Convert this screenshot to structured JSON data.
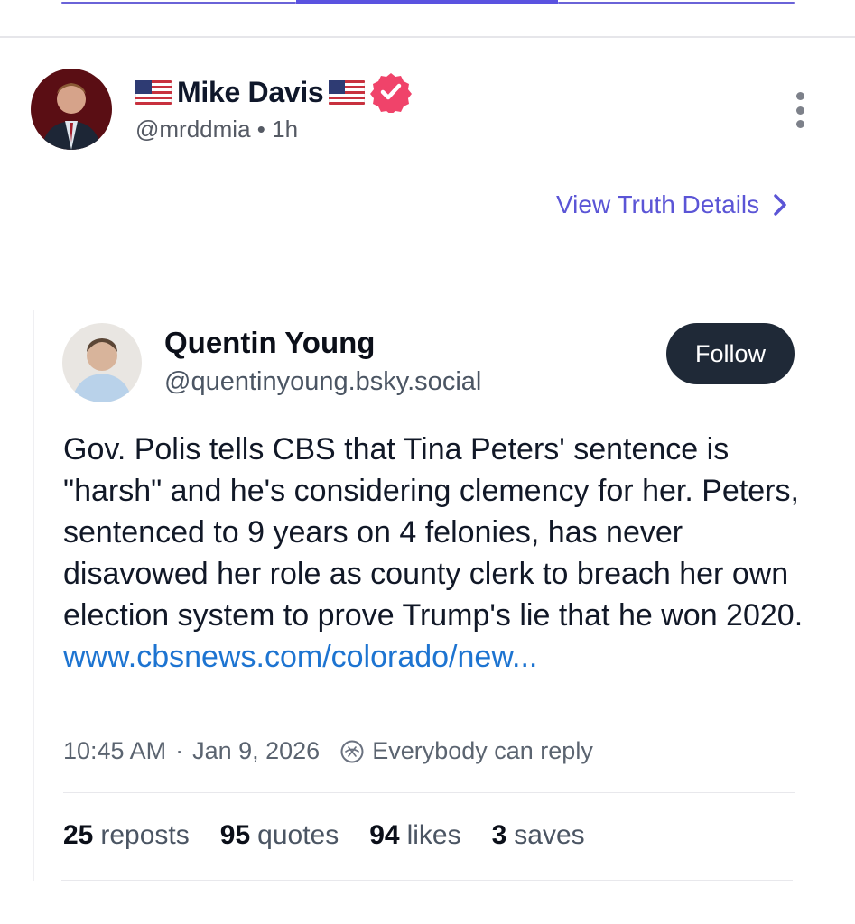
{
  "post": {
    "display_name": "Mike Davis",
    "handle": "@mrddmia",
    "time_sep": "•",
    "time": "1h",
    "view_details": "View Truth Details",
    "icons": {
      "avatar": "avatar-photo",
      "flag": "us-flag-icon",
      "verified": "verified-badge-icon",
      "more": "more-vertical-icon",
      "chevron": "chevron-right-icon"
    }
  },
  "quote": {
    "name": "Quentin Young",
    "handle": "@quentinyoung.bsky.social",
    "follow_label": "Follow",
    "body": "Gov. Polis tells CBS that Tina Peters' sentence is \"harsh\" and he's considering clemency for her. Peters, sentenced to 9 years on 4 felonies, has never disavowed her role as county clerk to breach her own election system to prove Trump's lie that he won 2020.",
    "link": "www.cbsnews.com/colorado/new...",
    "time": "10:45 AM",
    "dot": "·",
    "date": "Jan 9, 2026",
    "reply_setting": "Everybody can reply",
    "stats": [
      {
        "count": "25",
        "label": "reposts"
      },
      {
        "count": "95",
        "label": "quotes"
      },
      {
        "count": "94",
        "label": "likes"
      },
      {
        "count": "3",
        "label": "saves"
      }
    ]
  },
  "colors": {
    "accent": "#5b55d6",
    "verified": "#f0436a",
    "link": "#1d74d1",
    "follow_bg": "#1f2937"
  }
}
